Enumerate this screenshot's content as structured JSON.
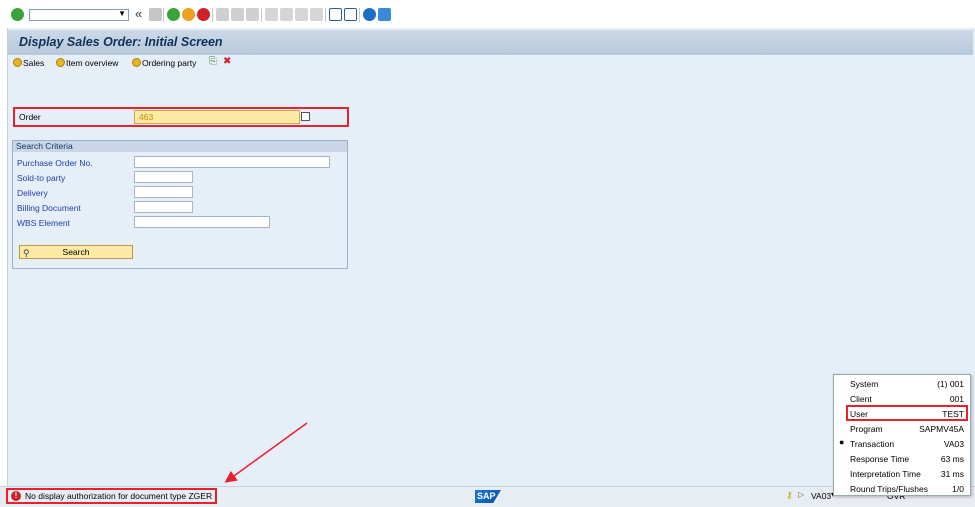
{
  "toolbar": {
    "command_field_value": "",
    "enter_icon": "enter-check-icon",
    "icons": [
      "save-icon",
      "back-icon",
      "exit-icon",
      "cancel-icon",
      "print-icon",
      "find-icon",
      "find-next-icon",
      "first-page-icon",
      "prev-page-icon",
      "next-page-icon",
      "last-page-icon",
      "new-session-icon",
      "shortcut-icon",
      "help-icon",
      "customize-layout-icon"
    ]
  },
  "title": "Display Sales Order: Initial Screen",
  "app_toolbar": {
    "sales": "Sales",
    "item_overview": "Item overview",
    "ordering_party": "Ordering party"
  },
  "order": {
    "label": "Order",
    "value": "463"
  },
  "search_criteria": {
    "title": "Search Criteria",
    "fields": [
      {
        "label": "Purchase Order No.",
        "value": ""
      },
      {
        "label": "Sold-to party",
        "value": ""
      },
      {
        "label": "Delivery",
        "value": ""
      },
      {
        "label": "Billing Document",
        "value": ""
      },
      {
        "label": "WBS Element",
        "value": ""
      }
    ],
    "search_button": "Search"
  },
  "status": {
    "message": "No display authorization for document type ZGER",
    "tcode": "VA03",
    "mode": "OVR"
  },
  "sap_logo": "SAP",
  "system_info": {
    "rows": [
      {
        "key": "System",
        "value": "(1) 001"
      },
      {
        "key": "Client",
        "value": "001"
      },
      {
        "key": "User",
        "value": "TEST"
      },
      {
        "key": "Program",
        "value": "SAPMV45A"
      },
      {
        "key": "Transaction",
        "value": "VA03"
      },
      {
        "key": "Response Time",
        "value": "63 ms"
      },
      {
        "key": "Interpretation Time",
        "value": "31 ms"
      },
      {
        "key": "Round Trips/Flushes",
        "value": "1/0"
      }
    ]
  },
  "colors": {
    "highlight": "#e8212f",
    "title_text": "#10305a",
    "field_label": "#2040b0",
    "required_field_bg": "#fbe9a4"
  }
}
